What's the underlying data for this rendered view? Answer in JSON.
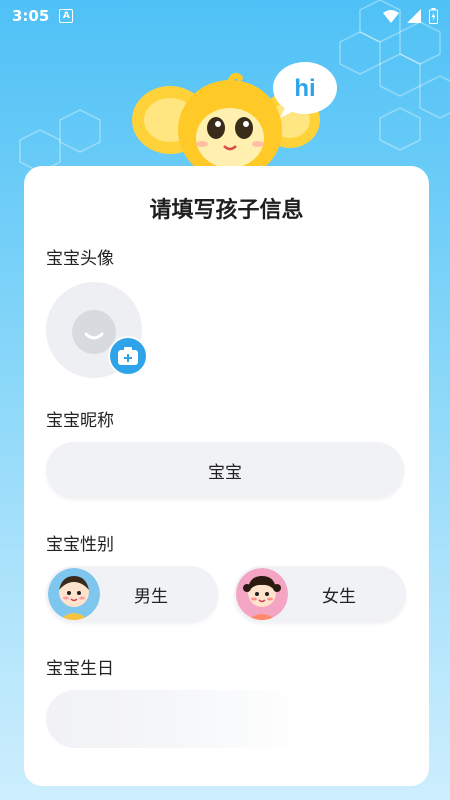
{
  "status_bar": {
    "time": "3:05",
    "notification_letter": "A"
  },
  "mascot": {
    "speech": "hi"
  },
  "form": {
    "title": "请填写孩子信息",
    "avatar_label": "宝宝头像",
    "nickname_label": "宝宝昵称",
    "nickname_value": "宝宝",
    "gender_label": "宝宝性别",
    "gender_options": [
      {
        "label": "男生",
        "icon": "boy-avatar-icon"
      },
      {
        "label": "女生",
        "icon": "girl-avatar-icon"
      }
    ],
    "birthday_label": "宝宝生日",
    "birthday_value": ""
  },
  "colors": {
    "accent": "#2fa3ea",
    "background_top": "#4fc1f6",
    "card": "#ffffff",
    "field": "#f1f2f5"
  }
}
